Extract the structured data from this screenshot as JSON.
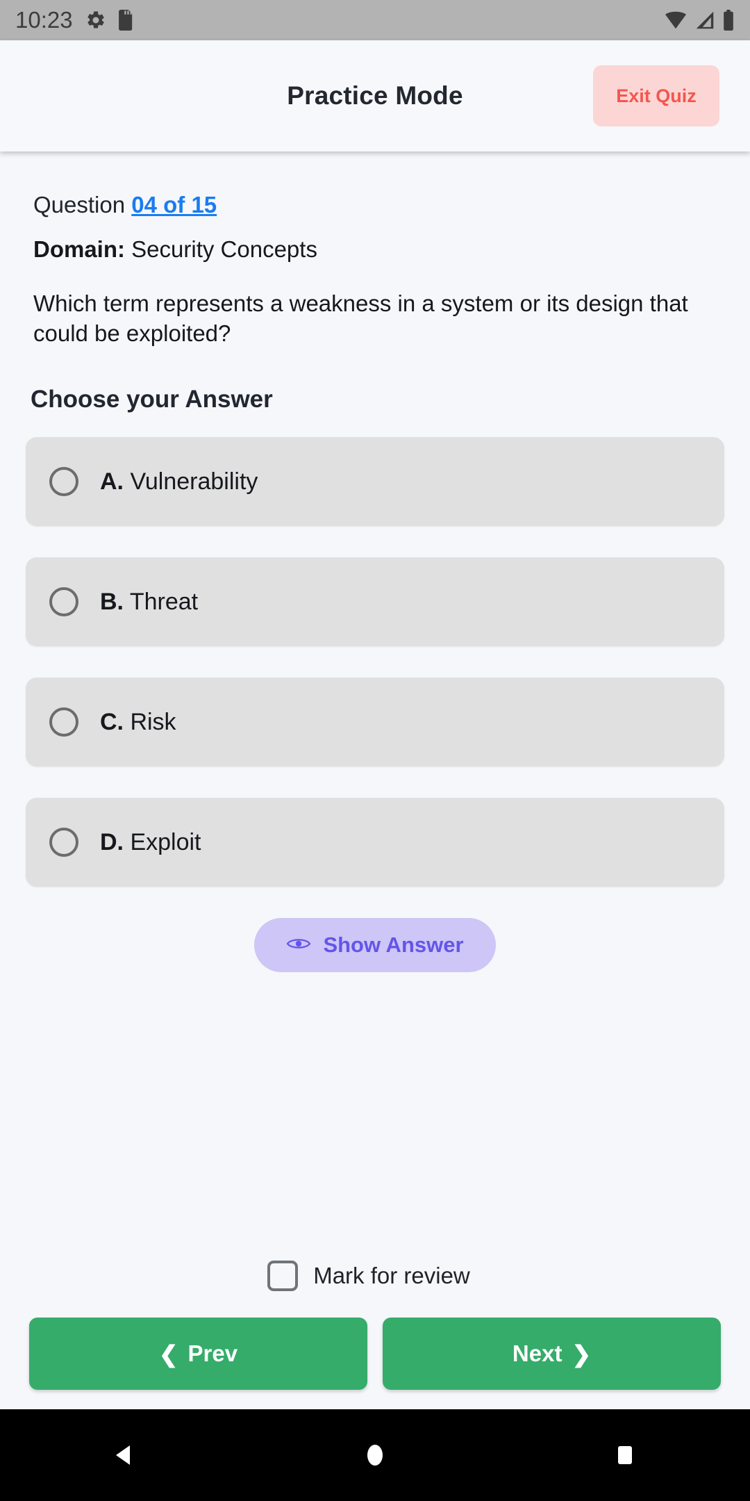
{
  "status_bar": {
    "time": "10:23",
    "left_icons": [
      "gear-icon",
      "sd-card-icon"
    ],
    "right_icons": [
      "wifi-icon",
      "cell-signal-icon",
      "battery-icon"
    ],
    "background_color": "#b3b3b3"
  },
  "app_bar": {
    "title": "Practice Mode",
    "exit_label": "Exit Quiz",
    "exit_bg": "#fbd6d4",
    "exit_text_color": "#f4564f"
  },
  "question": {
    "counter_prefix": "Question ",
    "counter_link": "04 of 15",
    "link_color": "#1a7cf0",
    "domain_label": "Domain:",
    "domain_value": " Security Concepts",
    "text": "Which term represents a weakness in a system or its design that could be exploited?"
  },
  "answers": {
    "heading": "Choose your Answer",
    "options": [
      {
        "letter": "A.",
        "text": " Vulnerability",
        "selected": false
      },
      {
        "letter": "B.",
        "text": " Threat",
        "selected": false
      },
      {
        "letter": "C.",
        "text": " Risk",
        "selected": false
      },
      {
        "letter": "D.",
        "text": " Exploit",
        "selected": false
      }
    ],
    "show_answer_label": "Show Answer",
    "show_answer_bg": "#cdc6f7",
    "show_answer_text_color": "#6455e8"
  },
  "footer": {
    "review_label": "Mark for review",
    "review_checked": false,
    "prev_label": "Prev",
    "next_label": "Next",
    "prev_chevron": "❮",
    "next_chevron": "❯",
    "button_color": "#35ac6a"
  },
  "android_nav": {
    "back": "back-triangle",
    "home": "home-circle",
    "recents": "recents-square"
  }
}
